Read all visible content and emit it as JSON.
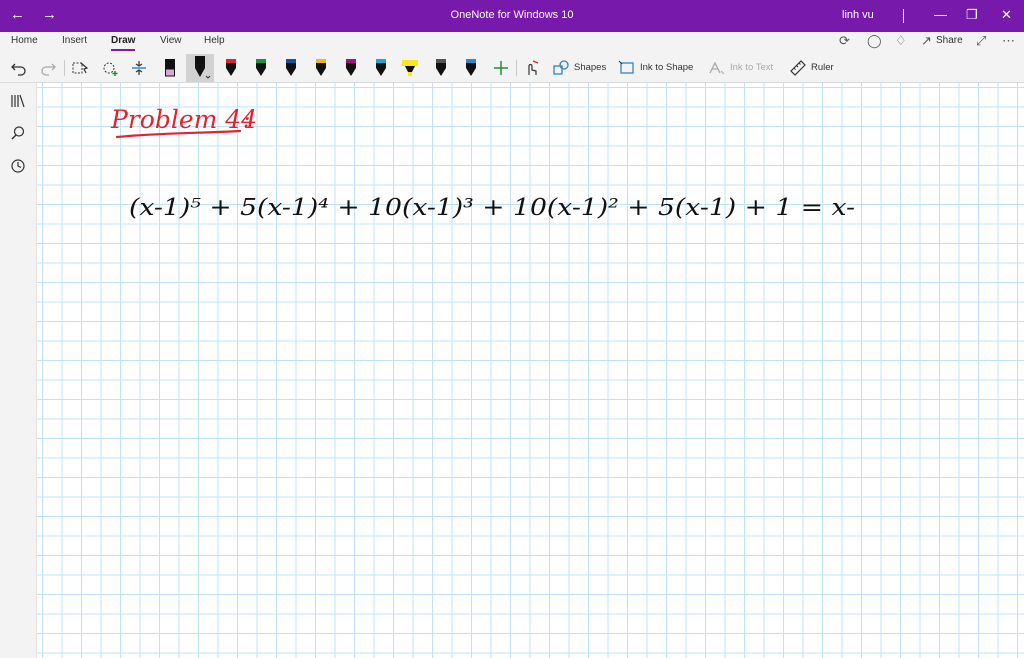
{
  "window": {
    "title": "OneNote for Windows 10",
    "user": "linh vu",
    "accent_color": "#7719AA"
  },
  "ribbon": {
    "tabs": [
      {
        "label": "Home"
      },
      {
        "label": "Insert"
      },
      {
        "label": "Draw",
        "active": true
      },
      {
        "label": "View"
      },
      {
        "label": "Help"
      }
    ],
    "share_label": "Share"
  },
  "toolbar": {
    "shapes_label": "Shapes",
    "ink_to_shape_label": "Ink to Shape",
    "ink_to_text_label": "Ink to Text",
    "ruler_label": "Ruler",
    "pen_colors": [
      "#7a2b6e",
      "#111111",
      "#e0232f",
      "#1f8f3a",
      "#1a4f9b",
      "#f2b51a",
      "#a0127e",
      "#1fa2d6",
      "#f7e81e",
      "#555555",
      "#2f86c8"
    ]
  },
  "page": {
    "heading": "Problem 44",
    "heading_suffix": ":",
    "heading_color": "#e0232f",
    "equation": "(x-1)⁵ + 5(x-1)⁴ + 10(x-1)³ + 10(x-1)² + 5(x-1) + 1 = x-"
  }
}
